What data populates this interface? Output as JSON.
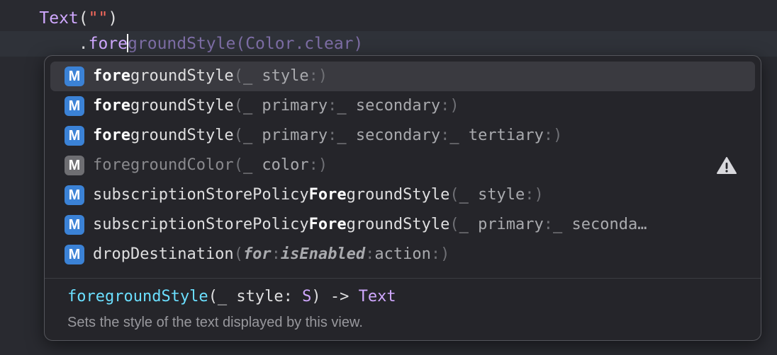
{
  "editor": {
    "line1": {
      "indent": "    ",
      "type": "Text",
      "open": "(",
      "string": "\"\"",
      "close": ")"
    },
    "line2": {
      "indent": "        ",
      "dot": ".",
      "typed": "fore",
      "ghost": "groundStyle",
      "ghost_args": "(Color.clear)"
    }
  },
  "completions": [
    {
      "kind": "M",
      "deprecated": false,
      "prefix": "",
      "match": "fore",
      "rest": "groundStyle",
      "args": "(_ style:)",
      "selected": true
    },
    {
      "kind": "M",
      "deprecated": false,
      "prefix": "",
      "match": "fore",
      "rest": "groundStyle",
      "args": "(_ primary:_ secondary:)",
      "selected": false
    },
    {
      "kind": "M",
      "deprecated": false,
      "prefix": "",
      "match": "fore",
      "rest": "groundStyle",
      "args": "(_ primary:_ secondary:_ tertiary:)",
      "selected": false
    },
    {
      "kind": "M",
      "deprecated": true,
      "prefix": "",
      "match": "fore",
      "rest": "groundColor",
      "args": "(_ color:)",
      "selected": false,
      "warning_icon": "warning-triangle-icon"
    },
    {
      "kind": "M",
      "deprecated": false,
      "prefix": "subscriptionStorePolicy",
      "match": "Fore",
      "rest": "groundStyle",
      "args": "(_ style:)",
      "selected": false
    },
    {
      "kind": "M",
      "deprecated": false,
      "prefix": "subscriptionStorePolicy",
      "match": "Fore",
      "rest": "groundStyle",
      "args": "(_ primary:_ seconda…",
      "selected": false
    },
    {
      "kind": "M",
      "deprecated": false,
      "prefix": "dropDestination",
      "match": "",
      "rest": "",
      "args": "(for:isEnabled:action:)",
      "selected": false
    }
  ],
  "detail": {
    "name": "foregroundStyle",
    "params": "(_ style: ",
    "generic": "S",
    "arrow": ") -> ",
    "return_type": "Text",
    "description": "Sets the style of the text displayed by this view."
  },
  "colors": {
    "background": "#292a30",
    "badge_method": "#3b82d6",
    "badge_deprecated": "#6e6e72",
    "signature_name": "#6bdfff",
    "type": "#d0a8ff"
  }
}
